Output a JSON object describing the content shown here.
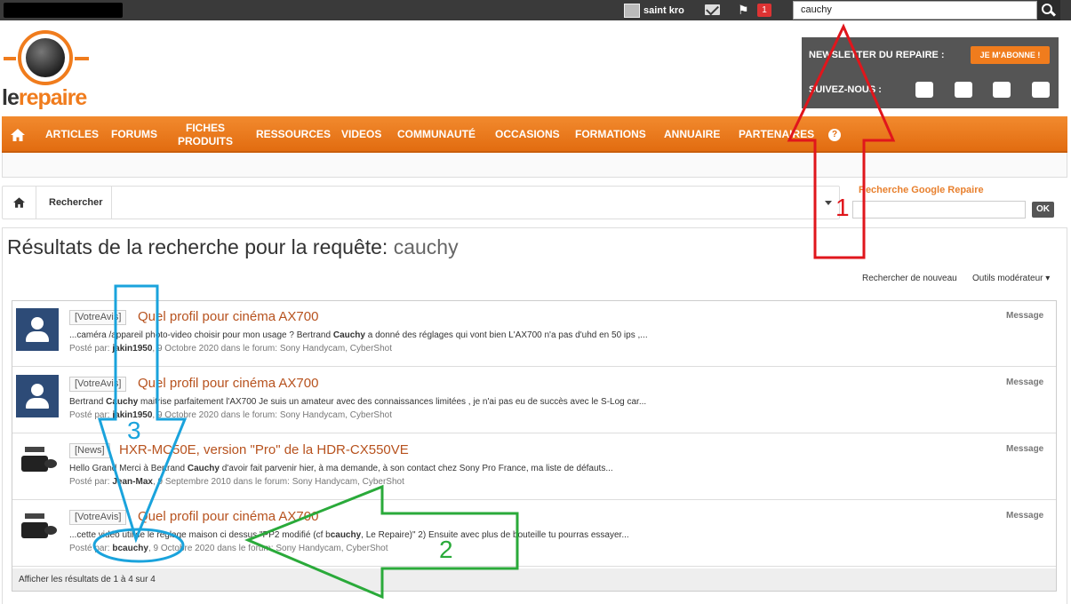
{
  "topbar": {
    "username": "saint kro",
    "notification_count": "1",
    "search_value": "cauchy"
  },
  "logo": {
    "le": "le",
    "repaire": "repaire"
  },
  "newsletter": {
    "label": "NEWSLETTER DU REPAIRE :",
    "subscribe": "JE M'ABONNE !",
    "follow": "SUIVEZ-NOUS :",
    "icons": [
      "youtube-icon",
      "instagram-icon",
      "facebook-icon",
      "twitter-icon"
    ]
  },
  "nav": {
    "items": [
      "ARTICLES",
      "FORUMS",
      "FICHES PRODUITS",
      "RESSOURCES",
      "VIDEOS",
      "COMMUNAUTÉ",
      "OCCASIONS",
      "FORMATIONS",
      "ANNUAIRE",
      "PARTENAIRES"
    ],
    "help": "?"
  },
  "breadcrumb": {
    "current": "Rechercher"
  },
  "google_search": {
    "label": "Recherche Google Repaire",
    "ok": "OK"
  },
  "page": {
    "title_prefix": "Résultats de la recherche pour la requête:",
    "query": "cauchy",
    "search_again": "Rechercher de nouveau",
    "mod_tools": "Outils modérateur"
  },
  "results": [
    {
      "prefix": "[VotreAvis]",
      "title": "Quel profil pour cinéma AX700",
      "snippet_pre": "...caméra /appareil photo-video choisir pour mon usage ? Bertrand ",
      "snippet_hl": "Cauchy",
      "snippet_post": " a donné des réglages qui vont bien L'AX700 n'a pas d'uhd en 50 ips ,...",
      "posted_by": "Posté par: ",
      "author": "jakin1950",
      "meta_rest": ", 9 Octobre 2020 dans le forum: Sony Handycam, CyberShot",
      "type": "Message"
    },
    {
      "prefix": "[VotreAvis]",
      "title": "Quel profil pour cinéma AX700",
      "snippet_pre": "Bertrand ",
      "snippet_hl": "Cauchy",
      "snippet_post": " maitrise parfaitement l'AX700 Je suis un amateur avec des connaissances limitées , je n'ai pas eu de succès avec le S-Log car...",
      "posted_by": "Posté par: ",
      "author": "jakin1950",
      "meta_rest": ", 9 Octobre 2020 dans le forum: Sony Handycam, CyberShot",
      "type": "Message"
    },
    {
      "prefix": "[News]",
      "title": "HXR-MC50E, version \"Pro\" de la HDR-CX550VE",
      "snippet_pre": "Hello Grand Merci à Bertrand ",
      "snippet_hl": "Cauchy",
      "snippet_post": " d'avoir fait parvenir hier, à ma demande, à son contact chez Sony Pro France, ma liste de défauts...",
      "posted_by": "Posté par: ",
      "author": "Jean-Max",
      "meta_rest": ", 9 Septembre 2010 dans le forum: Sony Handycam, CyberShot",
      "type": "Message"
    },
    {
      "prefix": "[VotreAvis]",
      "title": "Quel profil pour cinéma AX700",
      "snippet_pre": "...cette vidéo utilise le réglage maison ci dessus \"PP2 modifié (cf b",
      "snippet_hl": "cauchy",
      "snippet_post": ", Le Repaire)\" 2) Ensuite avec plus de bouteille tu pourras essayer...",
      "posted_by": "Posté par: ",
      "author": "bcauchy",
      "meta_rest": ", 9 Octobre 2020 dans le forum: Sony Handycam, CyberShot",
      "type": "Message"
    }
  ],
  "results_footer": "Afficher les résultats de 1 à 4 sur 4",
  "annotations": {
    "label1": "1",
    "label2": "2",
    "label3": "3"
  }
}
